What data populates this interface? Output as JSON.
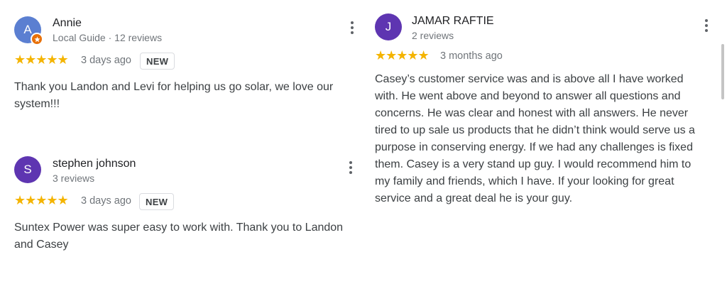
{
  "reviews": [
    {
      "avatar_letter": "A",
      "avatar_color": "#5b7fd1",
      "name": "Annie",
      "meta": "Local Guide · 12 reviews",
      "stars": "★★★★★",
      "rating": 5,
      "time": "3 days ago",
      "badge": "NEW",
      "text": "Thank you Landon and Levi for helping us go solar, we love our system!!!"
    },
    {
      "avatar_letter": "S",
      "avatar_color": "#5e35b1",
      "name": "stephen johnson",
      "meta": "3 reviews",
      "stars": "★★★★★",
      "rating": 5,
      "time": "3 days ago",
      "badge": "NEW",
      "text": "Suntex Power was super easy to work with. Thank you to Landon and Casey"
    },
    {
      "avatar_letter": "J",
      "avatar_color": "#5e35b1",
      "name": "JAMAR RAFTIE",
      "meta": "2 reviews",
      "stars": "★★★★★",
      "rating": 5,
      "time": "3 months ago",
      "text": "Casey’s customer service was and is above all I have worked with. He went above and beyond to answer all questions and concerns. He was clear and honest with all answers. He never tired to up sale us products that he didn’t think would serve us a purpose in conserving energy. If we had any challenges is fixed them. Casey is a very stand up guy. I would recommend him to my family and friends, which I have. If your looking for great service and a great deal he is your guy."
    }
  ],
  "icons": {
    "more": "more-vert-icon",
    "local_guide": "local-guide-star-icon"
  },
  "colors": {
    "star": "#f4b400",
    "local_guide_badge": "#e8710a"
  }
}
